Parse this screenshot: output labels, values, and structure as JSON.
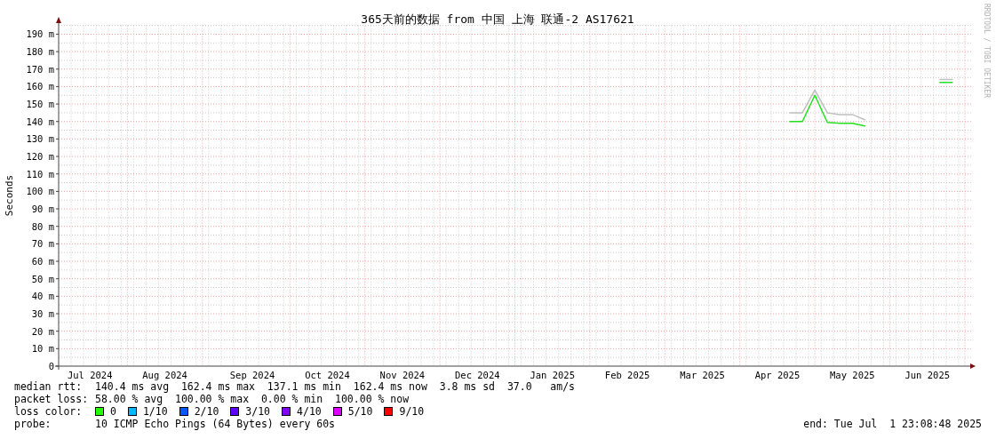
{
  "title": "365天前的数据 from 中国 上海 联通-2 AS17621",
  "credit": "RRDTOOL / TOBI OETIKER",
  "chart": {
    "chart_data": {
      "type": "line",
      "grid": true,
      "ylabel": "Seconds",
      "ylim": [
        0,
        195
      ],
      "categories": [
        null,
        null,
        "Jul 2024",
        null,
        null,
        null,
        null,
        null,
        "Aug 2024",
        null,
        null,
        null,
        null,
        null,
        null,
        "Sep 2024",
        null,
        null,
        null,
        null,
        null,
        "Oct 2024",
        null,
        null,
        null,
        null,
        null,
        "Nov 2024",
        null,
        null,
        null,
        null,
        null,
        "Dec 2024",
        null,
        null,
        null,
        null,
        null,
        "Jan 2025",
        null,
        null,
        null,
        null,
        null,
        "Feb 2025",
        null,
        null,
        null,
        null,
        null,
        "Mar 2025",
        null,
        null,
        null,
        null,
        null,
        "Apr 2025",
        null,
        null,
        null,
        null,
        null,
        "May 2025",
        null,
        null,
        null,
        null,
        null,
        "Jun 2025",
        null,
        null,
        null
      ],
      "yticks": [
        {
          "value": 0,
          "label": "0"
        },
        {
          "value": 10,
          "label": "10 m"
        },
        {
          "value": 20,
          "label": "20 m"
        },
        {
          "value": 30,
          "label": "30 m"
        },
        {
          "value": 40,
          "label": "40 m"
        },
        {
          "value": 50,
          "label": "50 m"
        },
        {
          "value": 60,
          "label": "60 m"
        },
        {
          "value": 70,
          "label": "70 m"
        },
        {
          "value": 80,
          "label": "80 m"
        },
        {
          "value": 90,
          "label": "90 m"
        },
        {
          "value": 100,
          "label": "100 m"
        },
        {
          "value": 110,
          "label": "110 m"
        },
        {
          "value": 120,
          "label": "120 m"
        },
        {
          "value": 130,
          "label": "130 m"
        },
        {
          "value": 140,
          "label": "140 m"
        },
        {
          "value": 150,
          "label": "150 m"
        },
        {
          "value": 160,
          "label": "160 m"
        },
        {
          "value": 170,
          "label": "170 m"
        },
        {
          "value": 180,
          "label": "180 m"
        },
        {
          "value": 190,
          "label": "190 m"
        }
      ],
      "series": [
        {
          "color": "#c0c0c0",
          "values": [
            null,
            null,
            null,
            null,
            null,
            null,
            null,
            null,
            null,
            null,
            null,
            null,
            null,
            null,
            null,
            null,
            null,
            null,
            null,
            null,
            null,
            null,
            null,
            null,
            null,
            null,
            null,
            null,
            null,
            null,
            null,
            null,
            null,
            null,
            null,
            null,
            null,
            null,
            null,
            null,
            null,
            null,
            null,
            null,
            null,
            null,
            null,
            null,
            null,
            null,
            null,
            null,
            null,
            null,
            null,
            null,
            null,
            null,
            145,
            145,
            158,
            145,
            144,
            144,
            141,
            null,
            null,
            null,
            null,
            null,
            164,
            164,
            null
          ]
        },
        {
          "color": "#20e020",
          "values": [
            null,
            null,
            null,
            null,
            null,
            null,
            null,
            null,
            null,
            null,
            null,
            null,
            null,
            null,
            null,
            null,
            null,
            null,
            null,
            null,
            null,
            null,
            null,
            null,
            null,
            null,
            null,
            null,
            null,
            null,
            null,
            null,
            null,
            null,
            null,
            null,
            null,
            null,
            null,
            null,
            null,
            null,
            null,
            null,
            null,
            null,
            null,
            null,
            null,
            null,
            null,
            null,
            null,
            null,
            null,
            null,
            null,
            null,
            140,
            140,
            155,
            139.5,
            139,
            139,
            137.5,
            null,
            null,
            null,
            null,
            null,
            162.4,
            162.4,
            null
          ]
        }
      ]
    }
  },
  "stats": [
    {
      "label": "median rtt:",
      "text": "140.4 ms avg  162.4 ms max  137.1 ms min  162.4 ms now  3.8 ms sd  37.0   am/s"
    },
    {
      "label": "packet loss:",
      "text": "58.00 % avg  100.00 % max  0.00 % min  100.00 % now"
    }
  ],
  "loss_color": {
    "label": "loss color:",
    "items": [
      {
        "label": "0",
        "color": "#26ff00"
      },
      {
        "label": "1/10",
        "color": "#00b8ff"
      },
      {
        "label": "2/10",
        "color": "#0059ff"
      },
      {
        "label": "3/10",
        "color": "#5e00ff"
      },
      {
        "label": "4/10",
        "color": "#7e00ff"
      },
      {
        "label": "5/10",
        "color": "#dd00ff"
      },
      {
        "label": "9/10",
        "color": "#ff0000"
      }
    ]
  },
  "probe": {
    "label": "probe:",
    "text": "10 ICMP Echo Pings (64 Bytes) every 60s"
  },
  "end": "end: Tue Jul  1 23:08:48 2025"
}
